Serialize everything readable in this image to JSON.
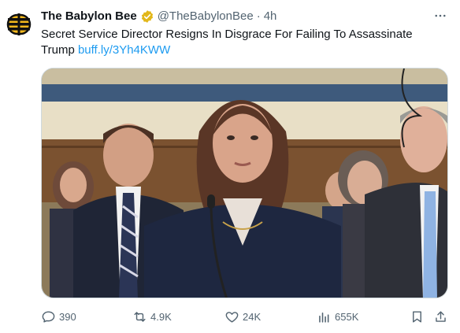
{
  "post": {
    "display_name": "The Babylon Bee",
    "handle": "@TheBabylonBee",
    "separator": "·",
    "timestamp": "4h",
    "text": "Secret Service Director Resigns In Disgrace For Failing To Assassinate Trump",
    "link": "buff.ly/3Yh4KWW"
  },
  "stats": {
    "replies": "390",
    "reposts": "4.9K",
    "likes": "24K",
    "views": "655K"
  },
  "icons": {
    "avatar": "babylon-bee-logo",
    "verified": "verified-badge-gold",
    "more": "more-horizontal-icon",
    "reply": "reply-icon",
    "repost": "repost-icon",
    "like": "heart-icon",
    "views": "analytics-icon",
    "bookmark": "bookmark-icon",
    "share": "share-icon"
  },
  "colors": {
    "link": "#1d9bf0",
    "muted": "#536471",
    "verified": "#e2b719",
    "text": "#0f1419"
  }
}
